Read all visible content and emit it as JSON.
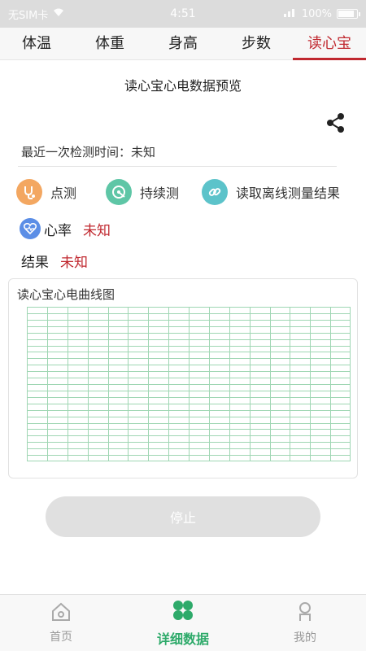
{
  "status_bar": {
    "carrier": "无SIM卡",
    "time": "4:51",
    "battery": "100%"
  },
  "tabs": [
    {
      "label": "体温"
    },
    {
      "label": "体重"
    },
    {
      "label": "身高"
    },
    {
      "label": "步数"
    },
    {
      "label": "读心宝"
    }
  ],
  "active_tab": "读心宝",
  "page_title": "读心宝心电数据预览",
  "last_detect": {
    "text": "最近一次检测时间：未知"
  },
  "actions": {
    "spot": "点测",
    "continuous": "持续测",
    "offline": "读取离线测量结果"
  },
  "heart_rate": {
    "label": "心率",
    "value": "未知"
  },
  "result": {
    "label": "结果",
    "value": "未知"
  },
  "ecg": {
    "title": "读心宝心电曲线图"
  },
  "stop_button": "停止",
  "bottom_nav": [
    {
      "label": "首页"
    },
    {
      "label": "详细数据"
    },
    {
      "label": "我的"
    }
  ],
  "colors": {
    "accent_red": "#c0282f",
    "accent_green": "#2eaa6a",
    "grid_line": "#9fd6b3"
  }
}
